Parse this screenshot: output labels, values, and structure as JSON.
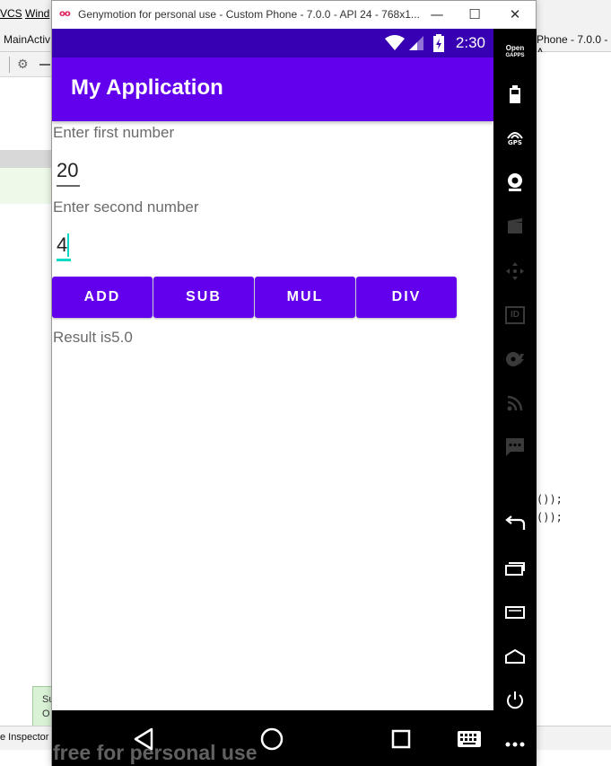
{
  "ide": {
    "menu_vcs": "VCS",
    "menu_window": "Wind",
    "tab_left": "MainActiv",
    "tab_right": "Phone - 7.0.0 - A",
    "code_line_1": "());",
    "code_line_2": "());",
    "toast_line_1": "Su",
    "toast_line_2": "O",
    "status_text": "e Inspector"
  },
  "emulator": {
    "window_title": "Genymotion for personal use - Custom Phone - 7.0.0 - API 24 - 768x1...",
    "logo_glyph": "oo",
    "minimize_glyph": "—",
    "maximize_glyph": "☐",
    "close_glyph": "✕",
    "watermark": "free for personal use",
    "side_gapps_line_1": "Open",
    "side_gapps_line_2": "GAPPS",
    "side_gps_label": "GPS",
    "side_id_label": "ID"
  },
  "phone": {
    "status_time": "2:30",
    "app_title": "My Application",
    "first_label": "Enter first number",
    "first_value": "20",
    "second_label": "Enter second number",
    "second_value": "4",
    "buttons": {
      "add": "ADD",
      "sub": "SUB",
      "mul": "MUL",
      "div": "DIV"
    },
    "result_text": "Result is5.0"
  },
  "colors": {
    "primary": "#6200ee",
    "primary_dark": "#3700b3",
    "accent": "#03dac5"
  }
}
